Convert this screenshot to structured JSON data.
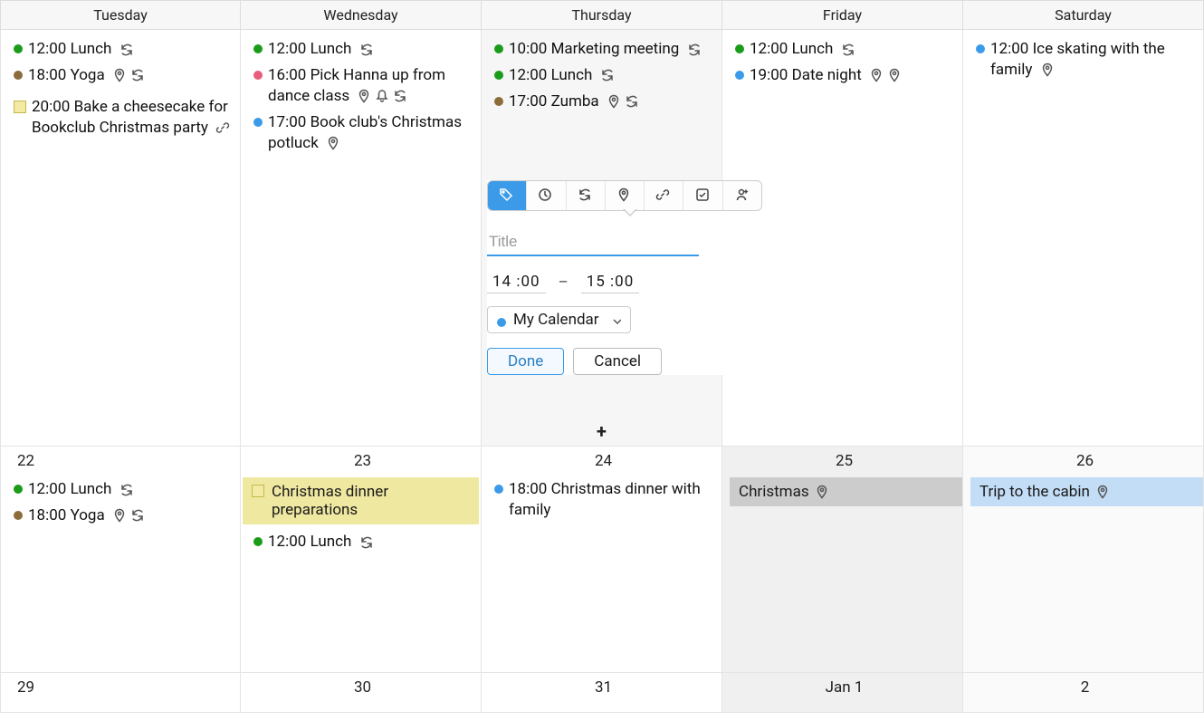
{
  "headers": [
    "Tuesday",
    "Wednesday",
    "Thursday",
    "Friday",
    "Saturday"
  ],
  "row1": {
    "tue": {
      "events": [
        {
          "color": "green",
          "time": "12:00",
          "title": "Lunch",
          "icons": [
            "repeat"
          ]
        },
        {
          "color": "brown",
          "time": "18:00",
          "title": "Yoga",
          "icons": [
            "location",
            "repeat"
          ]
        }
      ],
      "task": {
        "time": "20:00",
        "title": "Bake a cheesecake for Bookclub Christmas party",
        "icons": [
          "link"
        ]
      }
    },
    "wed": {
      "events": [
        {
          "color": "green",
          "time": "12:00",
          "title": "Lunch",
          "icons": [
            "repeat"
          ]
        },
        {
          "color": "pink",
          "time": "16:00",
          "title": "Pick Hanna up from dance class",
          "icons": [
            "location",
            "bell",
            "repeat"
          ]
        },
        {
          "color": "blue",
          "time": "17:00",
          "title": "Book club's Christmas potluck",
          "icons": [
            "location"
          ]
        }
      ]
    },
    "thu": {
      "events": [
        {
          "color": "green",
          "time": "10:00",
          "title": "Marketing meeting",
          "icons": [
            "repeat"
          ]
        },
        {
          "color": "green",
          "time": "12:00",
          "title": "Lunch",
          "icons": [
            "repeat"
          ]
        },
        {
          "color": "brown",
          "time": "17:00",
          "title": "Zumba",
          "icons": [
            "location",
            "repeat"
          ]
        }
      ]
    },
    "fri": {
      "events": [
        {
          "color": "green",
          "time": "12:00",
          "title": "Lunch",
          "icons": [
            "repeat"
          ]
        },
        {
          "color": "blue",
          "time": "19:00",
          "title": "Date night",
          "icons": [
            "location",
            "location"
          ]
        }
      ]
    },
    "sat": {
      "events": [
        {
          "color": "blue",
          "time": "12:00",
          "title": "Ice skating with the family",
          "icons": [
            "location"
          ]
        }
      ]
    }
  },
  "row2": {
    "tue": {
      "num": "22",
      "events": [
        {
          "color": "green",
          "time": "12:00",
          "title": "Lunch",
          "icons": [
            "repeat"
          ]
        },
        {
          "color": "brown",
          "time": "18:00",
          "title": "Yoga",
          "icons": [
            "location",
            "repeat"
          ]
        }
      ]
    },
    "wed": {
      "num": "23",
      "allday": {
        "title": "Christmas dinner preparations"
      },
      "events": [
        {
          "color": "green",
          "time": "12:00",
          "title": "Lunch",
          "icons": [
            "repeat"
          ]
        }
      ]
    },
    "thu": {
      "num": "24",
      "events": [
        {
          "color": "blue",
          "time": "18:00",
          "title": "Christmas dinner with family",
          "icons": []
        }
      ]
    },
    "fri": {
      "num": "25",
      "holiday": {
        "title": "Christmas",
        "icons": [
          "location"
        ]
      }
    },
    "sat": {
      "num": "26",
      "trip": {
        "title": "Trip to the cabin",
        "icons": [
          "location"
        ]
      }
    }
  },
  "row3": {
    "tue": "29",
    "wed": "30",
    "thu": "31",
    "fri": "Jan  1",
    "sat": "2"
  },
  "popover": {
    "title_placeholder": "Title",
    "start": "14 :00",
    "end": "15 :00",
    "dash": "–",
    "calendar": "My Calendar",
    "done": "Done",
    "cancel": "Cancel"
  },
  "add_glyph": "+"
}
